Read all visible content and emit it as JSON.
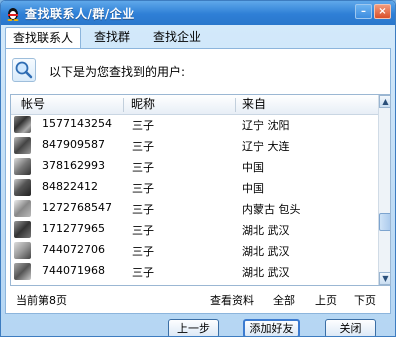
{
  "window": {
    "title": "查找联系人/群/企业"
  },
  "tabs": [
    {
      "label": "查找联系人",
      "active": true
    },
    {
      "label": "查找群",
      "active": false
    },
    {
      "label": "查找企业",
      "active": false
    }
  ],
  "hint": "以下是为您查找到的用户:",
  "table": {
    "columns": [
      "帐号",
      "昵称",
      "来自"
    ],
    "rows": [
      {
        "account": "1577143254",
        "nickname": "三子",
        "from": "辽宁 沈阳"
      },
      {
        "account": "847909587",
        "nickname": "三子",
        "from": "辽宁 大连"
      },
      {
        "account": "378162993",
        "nickname": "三子",
        "from": "中国"
      },
      {
        "account": "84822412",
        "nickname": "三子",
        "from": "中国"
      },
      {
        "account": "1272768547",
        "nickname": "三子",
        "from": "内蒙古 包头"
      },
      {
        "account": "171277965",
        "nickname": "三子",
        "from": "湖北 武汉"
      },
      {
        "account": "744072706",
        "nickname": "三子",
        "from": "湖北 武汉"
      },
      {
        "account": "744071968",
        "nickname": "三子",
        "from": "湖北 武汉"
      }
    ]
  },
  "footer": {
    "page_info": "当前第8页",
    "view_profile": "查看资料",
    "all": "全部",
    "prev_page": "上页",
    "next_page": "下页"
  },
  "buttons": {
    "back": "上一步",
    "add_friend": "添加好友",
    "close": "关闭"
  },
  "colors": {
    "titlebar": "#2e7fd6",
    "accent": "#3c7bd0"
  }
}
